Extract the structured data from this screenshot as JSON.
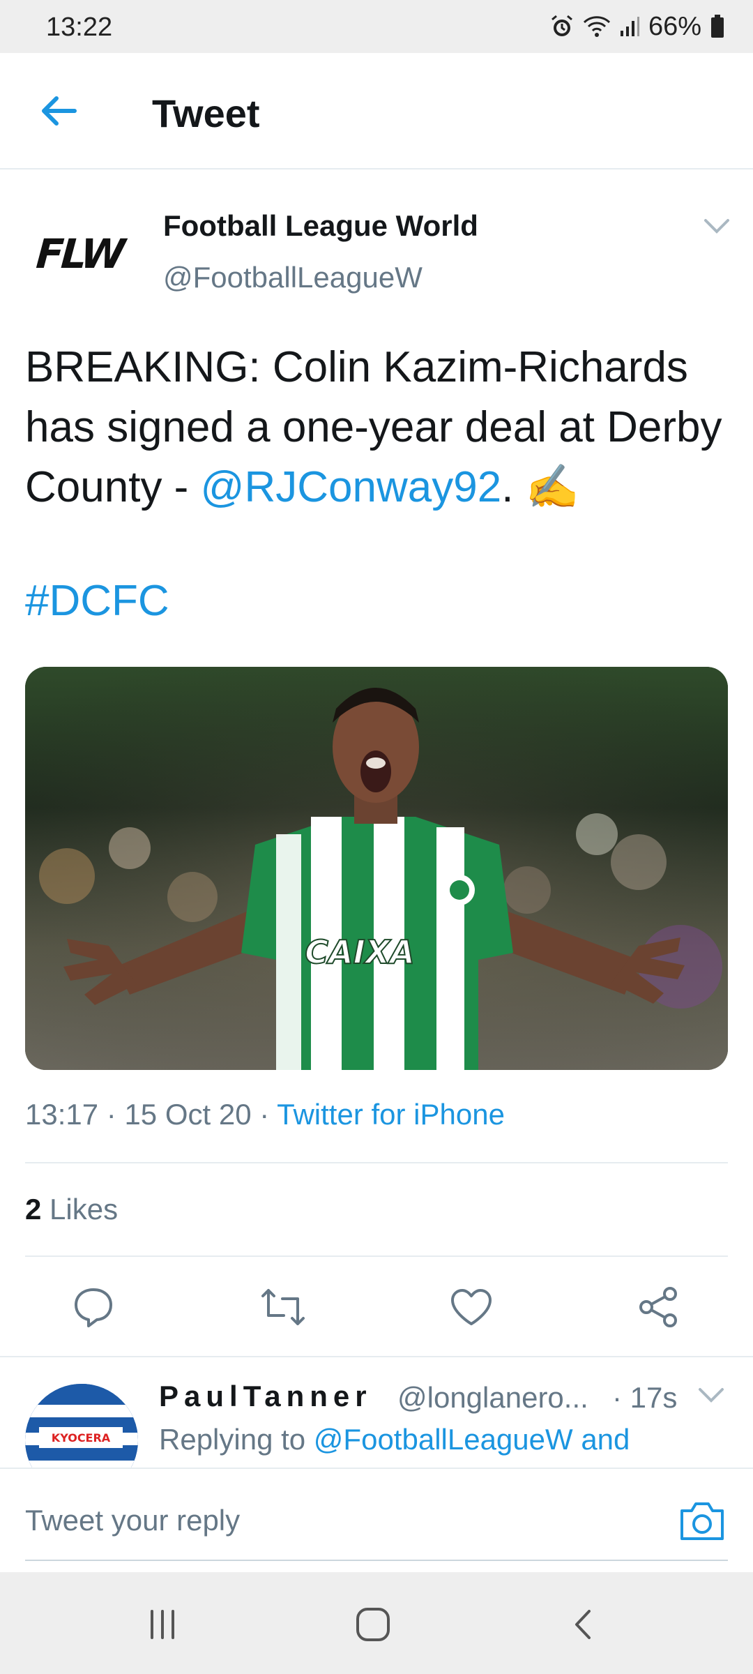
{
  "status": {
    "time": "13:22",
    "battery": "66%",
    "icons": [
      "alarm-icon",
      "wifi-icon",
      "signal-icon",
      "battery-icon"
    ]
  },
  "header": {
    "title": "Tweet",
    "back_icon": "back-arrow-icon"
  },
  "tweet": {
    "author_name": "Football League World",
    "author_handle": "@FootballLeagueW",
    "avatar_text": "FLW",
    "text_main": "BREAKING: Colin Kazim-Richards has signed a one-year deal at Derby County - ",
    "mention": "@RJConway92",
    "text_after": ". ",
    "emoji": "✍️",
    "hashtag": "#DCFC",
    "jersey_sponsor": "CAIXA",
    "time": "13:17",
    "date": "15 Oct 20",
    "source": "Twitter for iPhone",
    "likes_count": "2",
    "likes_label": "Likes"
  },
  "actions": [
    "reply-icon",
    "retweet-icon",
    "like-icon",
    "share-icon"
  ],
  "reply": {
    "name": "PaulTanner",
    "handle": "@longlanero...",
    "time": "· 17s",
    "replying_prefix": "Replying to ",
    "replying_to": "@FootballLeagueW and",
    "avatar_sponsor": "KYOCERA"
  },
  "compose": {
    "placeholder": "Tweet your reply"
  },
  "colors": {
    "accent": "#1b95e0",
    "text": "#14171a",
    "secondary": "#657786"
  }
}
